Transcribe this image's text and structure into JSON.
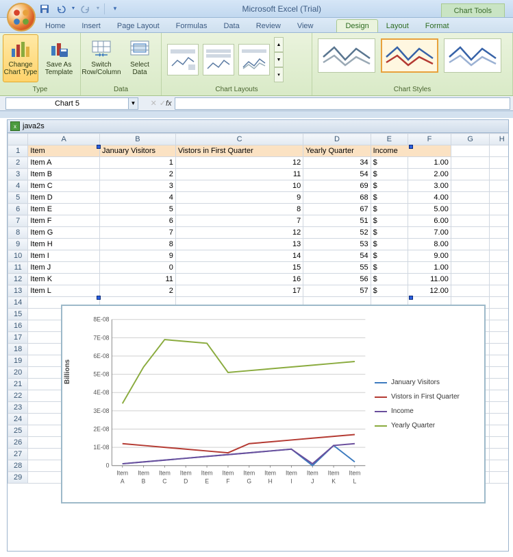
{
  "app_title": "Microsoft Excel (Trial)",
  "chart_tools_label": "Chart Tools",
  "tabs": {
    "home": "Home",
    "insert": "Insert",
    "page_layout": "Page Layout",
    "formulas": "Formulas",
    "data": "Data",
    "review": "Review",
    "view": "View",
    "design": "Design",
    "layout": "Layout",
    "format": "Format"
  },
  "ribbon": {
    "type_group": "Type",
    "data_group": "Data",
    "layouts_group": "Chart Layouts",
    "styles_group": "Chart Styles",
    "change_chart": "Change Chart Type",
    "save_as": "Save As Template",
    "switch": "Switch Row/Column",
    "select_data": "Select Data"
  },
  "name_box": "Chart 5",
  "workbook": "java2s",
  "columns": [
    "A",
    "B",
    "C",
    "D",
    "E",
    "F",
    "G",
    "H"
  ],
  "headers": {
    "A": "Item",
    "B": "January Visitors",
    "C": "Vistors in First Quarter",
    "D": "Yearly Quarter",
    "E": "Income"
  },
  "rows": [
    {
      "n": 1
    },
    {
      "n": 2,
      "A": "Item A",
      "B": "1",
      "C": "12",
      "D": "34",
      "E": "$",
      "F": "1.00"
    },
    {
      "n": 3,
      "A": "Item B",
      "B": "2",
      "C": "11",
      "D": "54",
      "E": "$",
      "F": "2.00"
    },
    {
      "n": 4,
      "A": "Item C",
      "B": "3",
      "C": "10",
      "D": "69",
      "E": "$",
      "F": "3.00"
    },
    {
      "n": 5,
      "A": "Item D",
      "B": "4",
      "C": "9",
      "D": "68",
      "E": "$",
      "F": "4.00"
    },
    {
      "n": 6,
      "A": "Item E",
      "B": "5",
      "C": "8",
      "D": "67",
      "E": "$",
      "F": "5.00"
    },
    {
      "n": 7,
      "A": "Item F",
      "B": "6",
      "C": "7",
      "D": "51",
      "E": "$",
      "F": "6.00"
    },
    {
      "n": 8,
      "A": "Item G",
      "B": "7",
      "C": "12",
      "D": "52",
      "E": "$",
      "F": "7.00"
    },
    {
      "n": 9,
      "A": "Item H",
      "B": "8",
      "C": "13",
      "D": "53",
      "E": "$",
      "F": "8.00"
    },
    {
      "n": 10,
      "A": "Item I",
      "B": "9",
      "C": "14",
      "D": "54",
      "E": "$",
      "F": "9.00"
    },
    {
      "n": 11,
      "A": "Item J",
      "B": "0",
      "C": "15",
      "D": "55",
      "E": "$",
      "F": "1.00"
    },
    {
      "n": 12,
      "A": "Item K",
      "B": "11",
      "C": "16",
      "D": "56",
      "E": "$",
      "F": "11.00"
    },
    {
      "n": 13,
      "A": "Item L",
      "B": "2",
      "C": "17",
      "D": "57",
      "E": "$",
      "F": "12.00"
    }
  ],
  "extra_rows": [
    14,
    15,
    16,
    17,
    18,
    19,
    20,
    21,
    22,
    23,
    24,
    25,
    26,
    27,
    28,
    29
  ],
  "chart_data": {
    "type": "line",
    "categories": [
      "Item A",
      "Item B",
      "Item C",
      "Item D",
      "Item E",
      "Item F",
      "Item G",
      "Item H",
      "Item I",
      "Item J",
      "Item K",
      "Item L"
    ],
    "series": [
      {
        "name": "January Visitors",
        "color": "#3d7bbf",
        "values": [
          1,
          2,
          3,
          4,
          5,
          6,
          7,
          8,
          9,
          0,
          11,
          2
        ]
      },
      {
        "name": "Vistors in First Quarter",
        "color": "#b43a32",
        "values": [
          12,
          11,
          10,
          9,
          8,
          7,
          12,
          13,
          14,
          15,
          16,
          17
        ]
      },
      {
        "name": "Income",
        "color": "#6a4e9c",
        "values": [
          1,
          2,
          3,
          4,
          5,
          6,
          7,
          8,
          9,
          1,
          11,
          12
        ]
      },
      {
        "name": "Yearly Quarter",
        "color": "#8aab3e",
        "values": [
          34,
          54,
          69,
          68,
          67,
          51,
          52,
          53,
          54,
          55,
          56,
          57
        ]
      }
    ],
    "ylabel": "Billions",
    "y_ticks": [
      "0",
      "1E-08",
      "2E-08",
      "3E-08",
      "4E-08",
      "5E-08",
      "6E-08",
      "7E-08",
      "8E-08"
    ],
    "ylim": [
      0,
      80
    ]
  }
}
